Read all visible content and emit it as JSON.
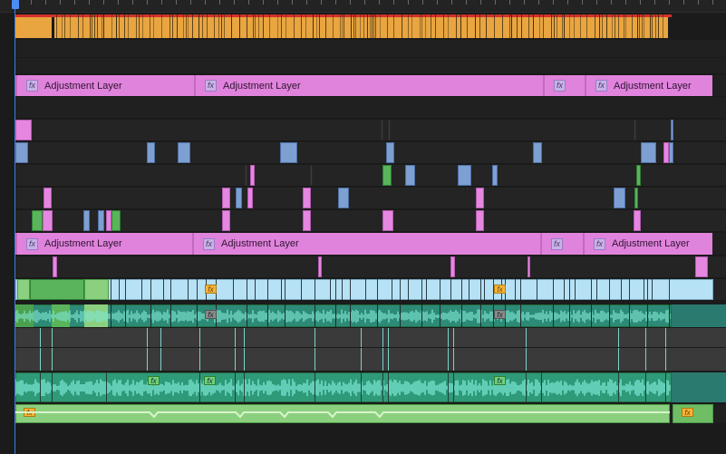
{
  "timeline": {
    "adjustment_label": "Adjustment Layer",
    "fx_label": "fx",
    "colors": {
      "background": "#1b1b1b",
      "adjustment": "#e083dc",
      "video_pink": "#e587e0",
      "video_blue": "#7d9fd2",
      "video_green": "#59b45b",
      "nested_cyan": "#b7e2f5",
      "audio_teal": "#3b9d63",
      "audio_music": "#8bd07f",
      "render_line": "#d5322b",
      "sequence_bar": "#e8a540",
      "playhead": "#3d7ee0"
    },
    "adjustment_rows": [
      {
        "clips": [
          {
            "label": "Adjustment Layer"
          },
          {
            "label": "Adjustment Layer"
          },
          {
            "label": ""
          },
          {
            "label": "Adjustment Layer"
          }
        ]
      },
      {
        "clips": [
          {
            "label": "Adjustment Layer"
          },
          {
            "label": "Adjustment Layer"
          },
          {
            "label": ""
          },
          {
            "label": "Adjustment Layer"
          }
        ]
      }
    ]
  }
}
